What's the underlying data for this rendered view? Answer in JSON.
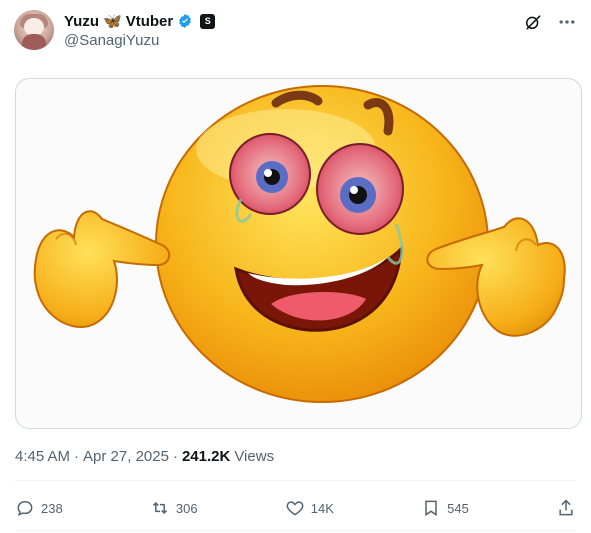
{
  "author": {
    "display_name": "Yuzu",
    "emoji": "🦋",
    "suffix": "Vtuber",
    "handle": "@SanagiYuzu",
    "affiliate_badge": "S"
  },
  "post": {
    "time": "4:45 AM",
    "date": "Apr 27, 2025",
    "views_count": "241.2K",
    "views_label": "Views"
  },
  "metrics": {
    "replies": "238",
    "reposts": "306",
    "likes": "14K",
    "bookmarks": "545"
  },
  "icons": {
    "verified": "verified-check-icon",
    "grok": "grok-icon",
    "more": "more-icon",
    "reply": "reply-icon",
    "repost": "repost-icon",
    "like": "heart-icon",
    "bookmark": "bookmark-icon",
    "share": "share-icon"
  },
  "colors": {
    "verified": "#1d9bf0",
    "text": "#0f1419",
    "muted": "#536471"
  }
}
